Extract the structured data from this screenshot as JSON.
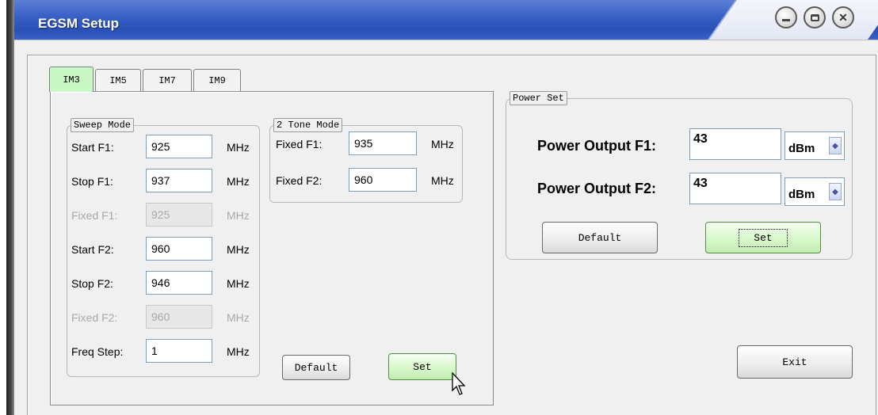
{
  "window": {
    "title": "EGSM Setup"
  },
  "tabs": [
    "IM3",
    "IM5",
    "IM7",
    "IM9"
  ],
  "sweep_mode": {
    "title": "Sweep Mode",
    "rows": [
      {
        "label": "Start F1:",
        "value": "925",
        "unit": "MHz",
        "enabled": true
      },
      {
        "label": "Stop F1:",
        "value": "937",
        "unit": "MHz",
        "enabled": true
      },
      {
        "label": "Fixed F1:",
        "value": "925",
        "unit": "MHz",
        "enabled": false
      },
      {
        "label": "Start F2:",
        "value": "960",
        "unit": "MHz",
        "enabled": true
      },
      {
        "label": "Stop F2:",
        "value": "946",
        "unit": "MHz",
        "enabled": true
      },
      {
        "label": "Fixed F2:",
        "value": "960",
        "unit": "MHz",
        "enabled": false
      },
      {
        "label": "Freq Step:",
        "value": "1",
        "unit": "MHz",
        "enabled": true
      }
    ]
  },
  "two_tone": {
    "title": "2 Tone Mode",
    "rows": [
      {
        "label": "Fixed F1:",
        "value": "935",
        "unit": "MHz"
      },
      {
        "label": "Fixed F2:",
        "value": "960",
        "unit": "MHz"
      }
    ]
  },
  "im_buttons": {
    "default": "Default",
    "set": "Set"
  },
  "power_set": {
    "title": "Power Set",
    "rows": [
      {
        "label": "Power Output F1:",
        "value": "43",
        "unit": "dBm"
      },
      {
        "label": "Power Output F2:",
        "value": "43",
        "unit": "dBm"
      }
    ],
    "default": "Default",
    "set": "Set"
  },
  "exit": "Exit"
}
